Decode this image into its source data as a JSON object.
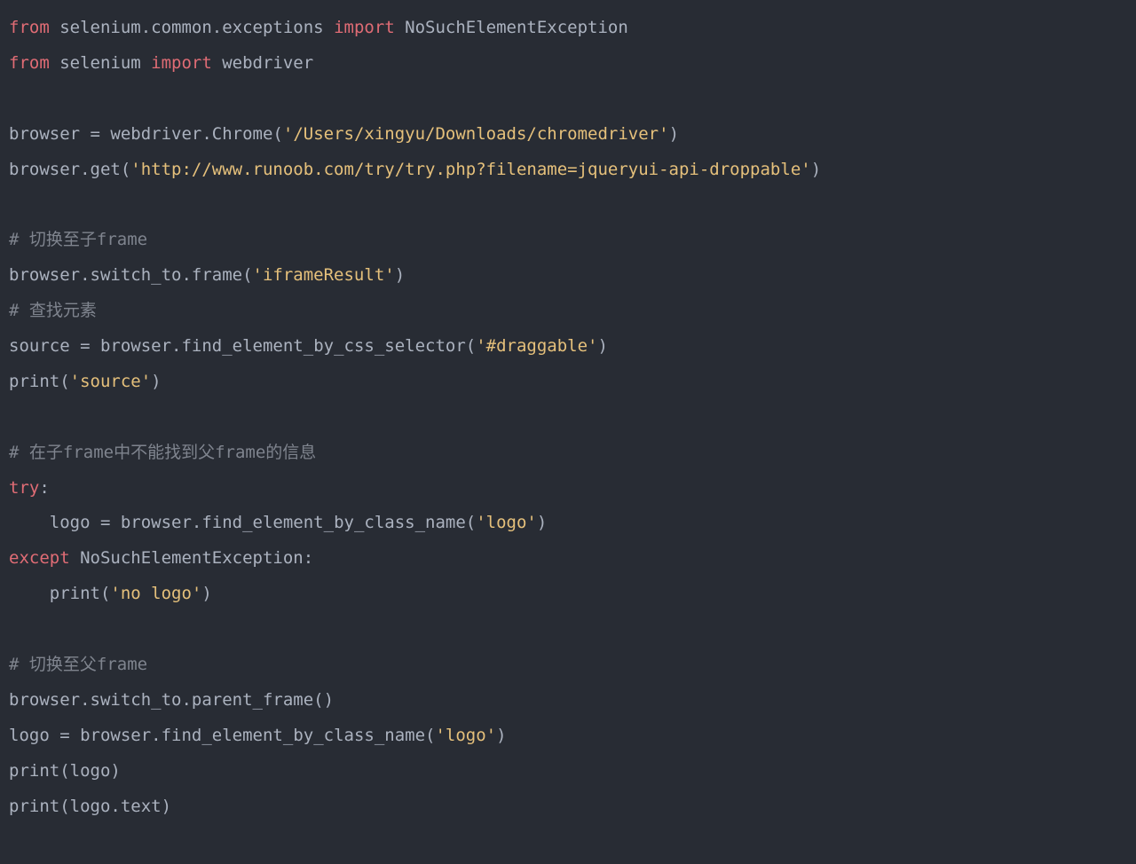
{
  "code": {
    "lines": [
      {
        "type": "tokens",
        "tokens": [
          {
            "cls": "kw",
            "t": "from"
          },
          {
            "cls": "ident",
            "t": " selenium.common.exceptions "
          },
          {
            "cls": "kw",
            "t": "import"
          },
          {
            "cls": "ident",
            "t": " NoSuchElementException"
          }
        ]
      },
      {
        "type": "tokens",
        "tokens": [
          {
            "cls": "kw",
            "t": "from"
          },
          {
            "cls": "ident",
            "t": " selenium "
          },
          {
            "cls": "kw",
            "t": "import"
          },
          {
            "cls": "ident",
            "t": " webdriver"
          }
        ]
      },
      {
        "type": "blank"
      },
      {
        "type": "tokens",
        "tokens": [
          {
            "cls": "ident",
            "t": "browser "
          },
          {
            "cls": "punct",
            "t": "="
          },
          {
            "cls": "ident",
            "t": " webdriver.Chrome("
          },
          {
            "cls": "str",
            "t": "'/Users/xingyu/Downloads/chromedriver'"
          },
          {
            "cls": "ident",
            "t": ")"
          }
        ]
      },
      {
        "type": "tokens",
        "tokens": [
          {
            "cls": "ident",
            "t": "browser.get("
          },
          {
            "cls": "str",
            "t": "'http://www.runoob.com/try/try.php?filename=jqueryui-api-droppable'"
          },
          {
            "cls": "ident",
            "t": ")"
          }
        ]
      },
      {
        "type": "blank"
      },
      {
        "type": "tokens",
        "tokens": [
          {
            "cls": "comment",
            "t": "# 切换至子frame"
          }
        ]
      },
      {
        "type": "tokens",
        "tokens": [
          {
            "cls": "ident",
            "t": "browser.switch_to.frame("
          },
          {
            "cls": "str",
            "t": "'iframeResult'"
          },
          {
            "cls": "ident",
            "t": ")"
          }
        ]
      },
      {
        "type": "tokens",
        "tokens": [
          {
            "cls": "comment",
            "t": "# 查找元素"
          }
        ]
      },
      {
        "type": "tokens",
        "tokens": [
          {
            "cls": "ident",
            "t": "source "
          },
          {
            "cls": "punct",
            "t": "="
          },
          {
            "cls": "ident",
            "t": " browser.find_element_by_css_selector("
          },
          {
            "cls": "str",
            "t": "'#draggable'"
          },
          {
            "cls": "ident",
            "t": ")"
          }
        ]
      },
      {
        "type": "tokens",
        "tokens": [
          {
            "cls": "builtin",
            "t": "print"
          },
          {
            "cls": "ident",
            "t": "("
          },
          {
            "cls": "str",
            "t": "'source'"
          },
          {
            "cls": "ident",
            "t": ")"
          }
        ]
      },
      {
        "type": "blank"
      },
      {
        "type": "tokens",
        "tokens": [
          {
            "cls": "comment",
            "t": "# 在子frame中不能找到父frame的信息"
          }
        ]
      },
      {
        "type": "tokens",
        "tokens": [
          {
            "cls": "kw",
            "t": "try"
          },
          {
            "cls": "punct",
            "t": ":"
          }
        ]
      },
      {
        "type": "tokens",
        "tokens": [
          {
            "cls": "ident",
            "t": "    logo "
          },
          {
            "cls": "punct",
            "t": "="
          },
          {
            "cls": "ident",
            "t": " browser.find_element_by_class_name("
          },
          {
            "cls": "str",
            "t": "'logo'"
          },
          {
            "cls": "ident",
            "t": ")"
          }
        ]
      },
      {
        "type": "tokens",
        "tokens": [
          {
            "cls": "kw",
            "t": "except"
          },
          {
            "cls": "ident",
            "t": " NoSuchElementException"
          },
          {
            "cls": "punct",
            "t": ":"
          }
        ]
      },
      {
        "type": "tokens",
        "tokens": [
          {
            "cls": "ident",
            "t": "    "
          },
          {
            "cls": "builtin",
            "t": "print"
          },
          {
            "cls": "ident",
            "t": "("
          },
          {
            "cls": "str",
            "t": "'no logo'"
          },
          {
            "cls": "ident",
            "t": ")"
          }
        ]
      },
      {
        "type": "blank"
      },
      {
        "type": "tokens",
        "tokens": [
          {
            "cls": "comment",
            "t": "# 切换至父frame"
          }
        ]
      },
      {
        "type": "tokens",
        "tokens": [
          {
            "cls": "ident",
            "t": "browser.switch_to.parent_frame()"
          }
        ]
      },
      {
        "type": "tokens",
        "tokens": [
          {
            "cls": "ident",
            "t": "logo "
          },
          {
            "cls": "punct",
            "t": "="
          },
          {
            "cls": "ident",
            "t": " browser.find_element_by_class_name("
          },
          {
            "cls": "str",
            "t": "'logo'"
          },
          {
            "cls": "ident",
            "t": ")"
          }
        ]
      },
      {
        "type": "tokens",
        "tokens": [
          {
            "cls": "builtin",
            "t": "print"
          },
          {
            "cls": "ident",
            "t": "(logo)"
          }
        ]
      },
      {
        "type": "tokens",
        "tokens": [
          {
            "cls": "builtin",
            "t": "print"
          },
          {
            "cls": "ident",
            "t": "(logo.text)"
          }
        ]
      }
    ]
  },
  "colors": {
    "background": "#282c34",
    "default": "#abb2bf",
    "keyword": "#e06c75",
    "string": "#e5c07b",
    "comment": "#7f848e"
  }
}
